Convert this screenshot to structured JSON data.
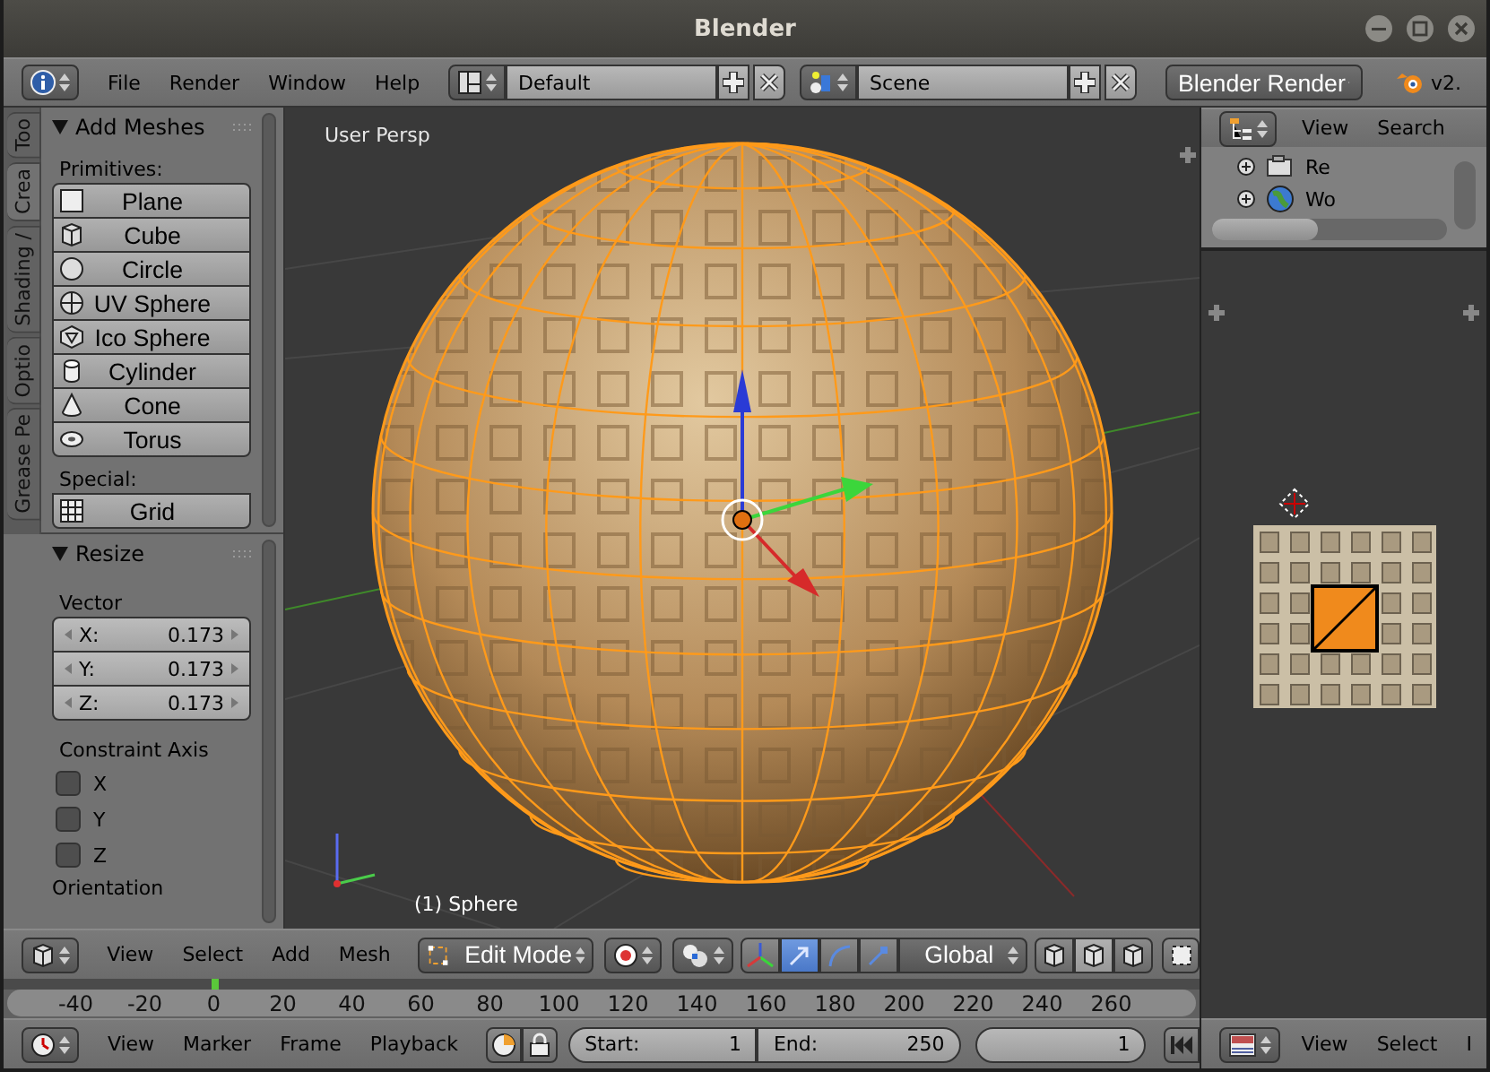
{
  "window": {
    "title": "Blender"
  },
  "info_header": {
    "menus": [
      "File",
      "Render",
      "Window",
      "Help"
    ],
    "layout": "Default",
    "scene": "Scene",
    "engine": "Blender Render",
    "version": "v2."
  },
  "tool_shelf": {
    "tabs": [
      {
        "label": "Too",
        "selected": false
      },
      {
        "label": "Crea",
        "selected": true
      },
      {
        "label": "Shading /",
        "selected": false
      },
      {
        "label": "Optio",
        "selected": false
      },
      {
        "label": "Grease Pe",
        "selected": false
      }
    ],
    "panel": {
      "title": "Add Meshes",
      "groups": [
        {
          "label": "Primitives:",
          "buttons": [
            "Plane",
            "Cube",
            "Circle",
            "UV Sphere",
            "Ico Sphere",
            "Cylinder",
            "Cone",
            "Torus"
          ]
        },
        {
          "label": "Special:",
          "buttons": [
            "Grid"
          ]
        }
      ]
    }
  },
  "operator": {
    "title": "Resize",
    "vector_label": "Vector",
    "vector": [
      {
        "axis": "X:",
        "value": "0.173"
      },
      {
        "axis": "Y:",
        "value": "0.173"
      },
      {
        "axis": "Z:",
        "value": "0.173"
      }
    ],
    "constraint_label": "Constraint Axis",
    "axes": [
      {
        "label": "X",
        "checked": false
      },
      {
        "label": "Y",
        "checked": false
      },
      {
        "label": "Z",
        "checked": false
      }
    ],
    "orientation_label": "Orientation"
  },
  "viewport": {
    "view_name": "User Persp",
    "object_label": "(1) Sphere"
  },
  "outliner": {
    "menus": [
      "View",
      "Search"
    ],
    "items": [
      {
        "label": "Re"
      },
      {
        "label": "Wo"
      }
    ]
  },
  "view3d_header": {
    "menus": [
      "View",
      "Select",
      "Add",
      "Mesh"
    ],
    "mode": "Edit Mode",
    "orientation": "Global"
  },
  "timeline": {
    "ticks": [
      "-40",
      "-20",
      "0",
      "20",
      "40",
      "60",
      "80",
      "100",
      "120",
      "140",
      "160",
      "180",
      "200",
      "220",
      "240",
      "260"
    ],
    "menus": [
      "View",
      "Marker",
      "Frame",
      "Playback"
    ],
    "start": {
      "label": "Start:",
      "value": "1"
    },
    "end": {
      "label": "End:",
      "value": "250"
    },
    "current": "1"
  },
  "image_header": {
    "menus": [
      "View",
      "Select",
      "I"
    ]
  }
}
